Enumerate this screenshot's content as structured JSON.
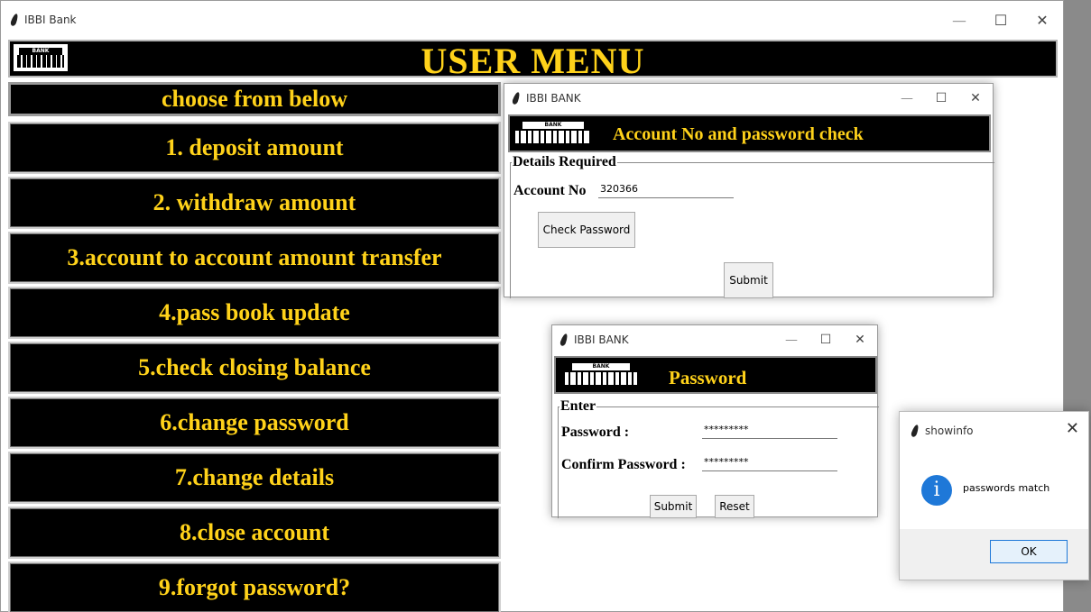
{
  "main_window": {
    "title": "IBBI Bank",
    "banner_title": "USER MENU",
    "logo_text": "BANK"
  },
  "menu": {
    "header": "choose from below",
    "items": [
      "1. deposit amount",
      "2. withdraw amount",
      "3.account to account amount transfer",
      "4.pass book update",
      "5.check closing balance",
      "6.change password",
      "7.change details",
      "8.close account",
      "9.forgot password?"
    ]
  },
  "account_dialog": {
    "title": "IBBI BANK",
    "banner_title": "Account No and password check",
    "section_label": "Details Required",
    "account_label": "Account No",
    "account_value": "320366",
    "check_button": "Check Password",
    "submit_button": "Submit"
  },
  "password_dialog": {
    "title": "IBBI BANK",
    "banner_title": "Password",
    "section_label": "Enter",
    "password_label": "Password :",
    "password_value": "*********",
    "confirm_label": "Confirm Password :",
    "confirm_value": "*********",
    "submit_button": "Submit",
    "reset_button": "Reset"
  },
  "info_dialog": {
    "title": "showinfo",
    "message": "passwords  match",
    "ok_button": "OK",
    "icon_glyph": "i"
  },
  "window_controls": {
    "minimize": "—",
    "maximize": "☐",
    "close": "✕"
  },
  "colors": {
    "menu_bg": "#000000",
    "menu_text": "#ffd21a",
    "info_icon": "#1e78d8"
  }
}
